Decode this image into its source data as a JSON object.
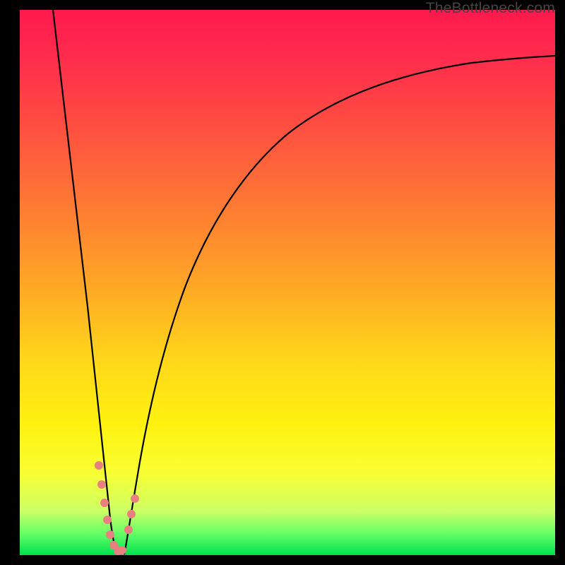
{
  "attribution": "TheBottleneck.com",
  "chart_data": {
    "type": "line",
    "title": "",
    "xlabel": "",
    "ylabel": "",
    "xlim": [
      0,
      100
    ],
    "ylim": [
      0,
      100
    ],
    "background_gradient": {
      "top_color": "#ff1a4d",
      "bottom_color": "#00e050",
      "description": "Vertical gradient red→orange→yellow→green representing bottleneck severity (high at top, low at bottom)"
    },
    "series": [
      {
        "name": "left-branch",
        "description": "Steep descending curve from top-left down to minimum near x≈17",
        "x": [
          6,
          8,
          10,
          12,
          14,
          15,
          16,
          17
        ],
        "y": [
          100,
          84,
          66,
          47,
          26,
          15,
          6,
          0
        ]
      },
      {
        "name": "right-branch",
        "description": "Ascending curve from minimum near x≈19 rising and flattening toward top-right",
        "x": [
          19,
          20,
          22,
          25,
          28,
          32,
          37,
          43,
          50,
          58,
          67,
          77,
          88,
          100
        ],
        "y": [
          0,
          6,
          17,
          30,
          41,
          51,
          60,
          68,
          74,
          79,
          83,
          86,
          88,
          90
        ]
      }
    ],
    "markers": {
      "description": "Short pink/salmon dotted segments near the bottom of each branch",
      "color": "#e98080",
      "points_left": [
        {
          "x": 14.2,
          "y": 16
        },
        {
          "x": 14.8,
          "y": 12
        },
        {
          "x": 15.4,
          "y": 8
        },
        {
          "x": 16.0,
          "y": 5
        },
        {
          "x": 16.6,
          "y": 2.5
        },
        {
          "x": 17.2,
          "y": 1
        },
        {
          "x": 17.8,
          "y": 0.5
        },
        {
          "x": 18.4,
          "y": 1
        }
      ],
      "points_right": [
        {
          "x": 19.6,
          "y": 5
        },
        {
          "x": 20.2,
          "y": 8
        },
        {
          "x": 20.8,
          "y": 11
        }
      ]
    },
    "annotations": []
  }
}
